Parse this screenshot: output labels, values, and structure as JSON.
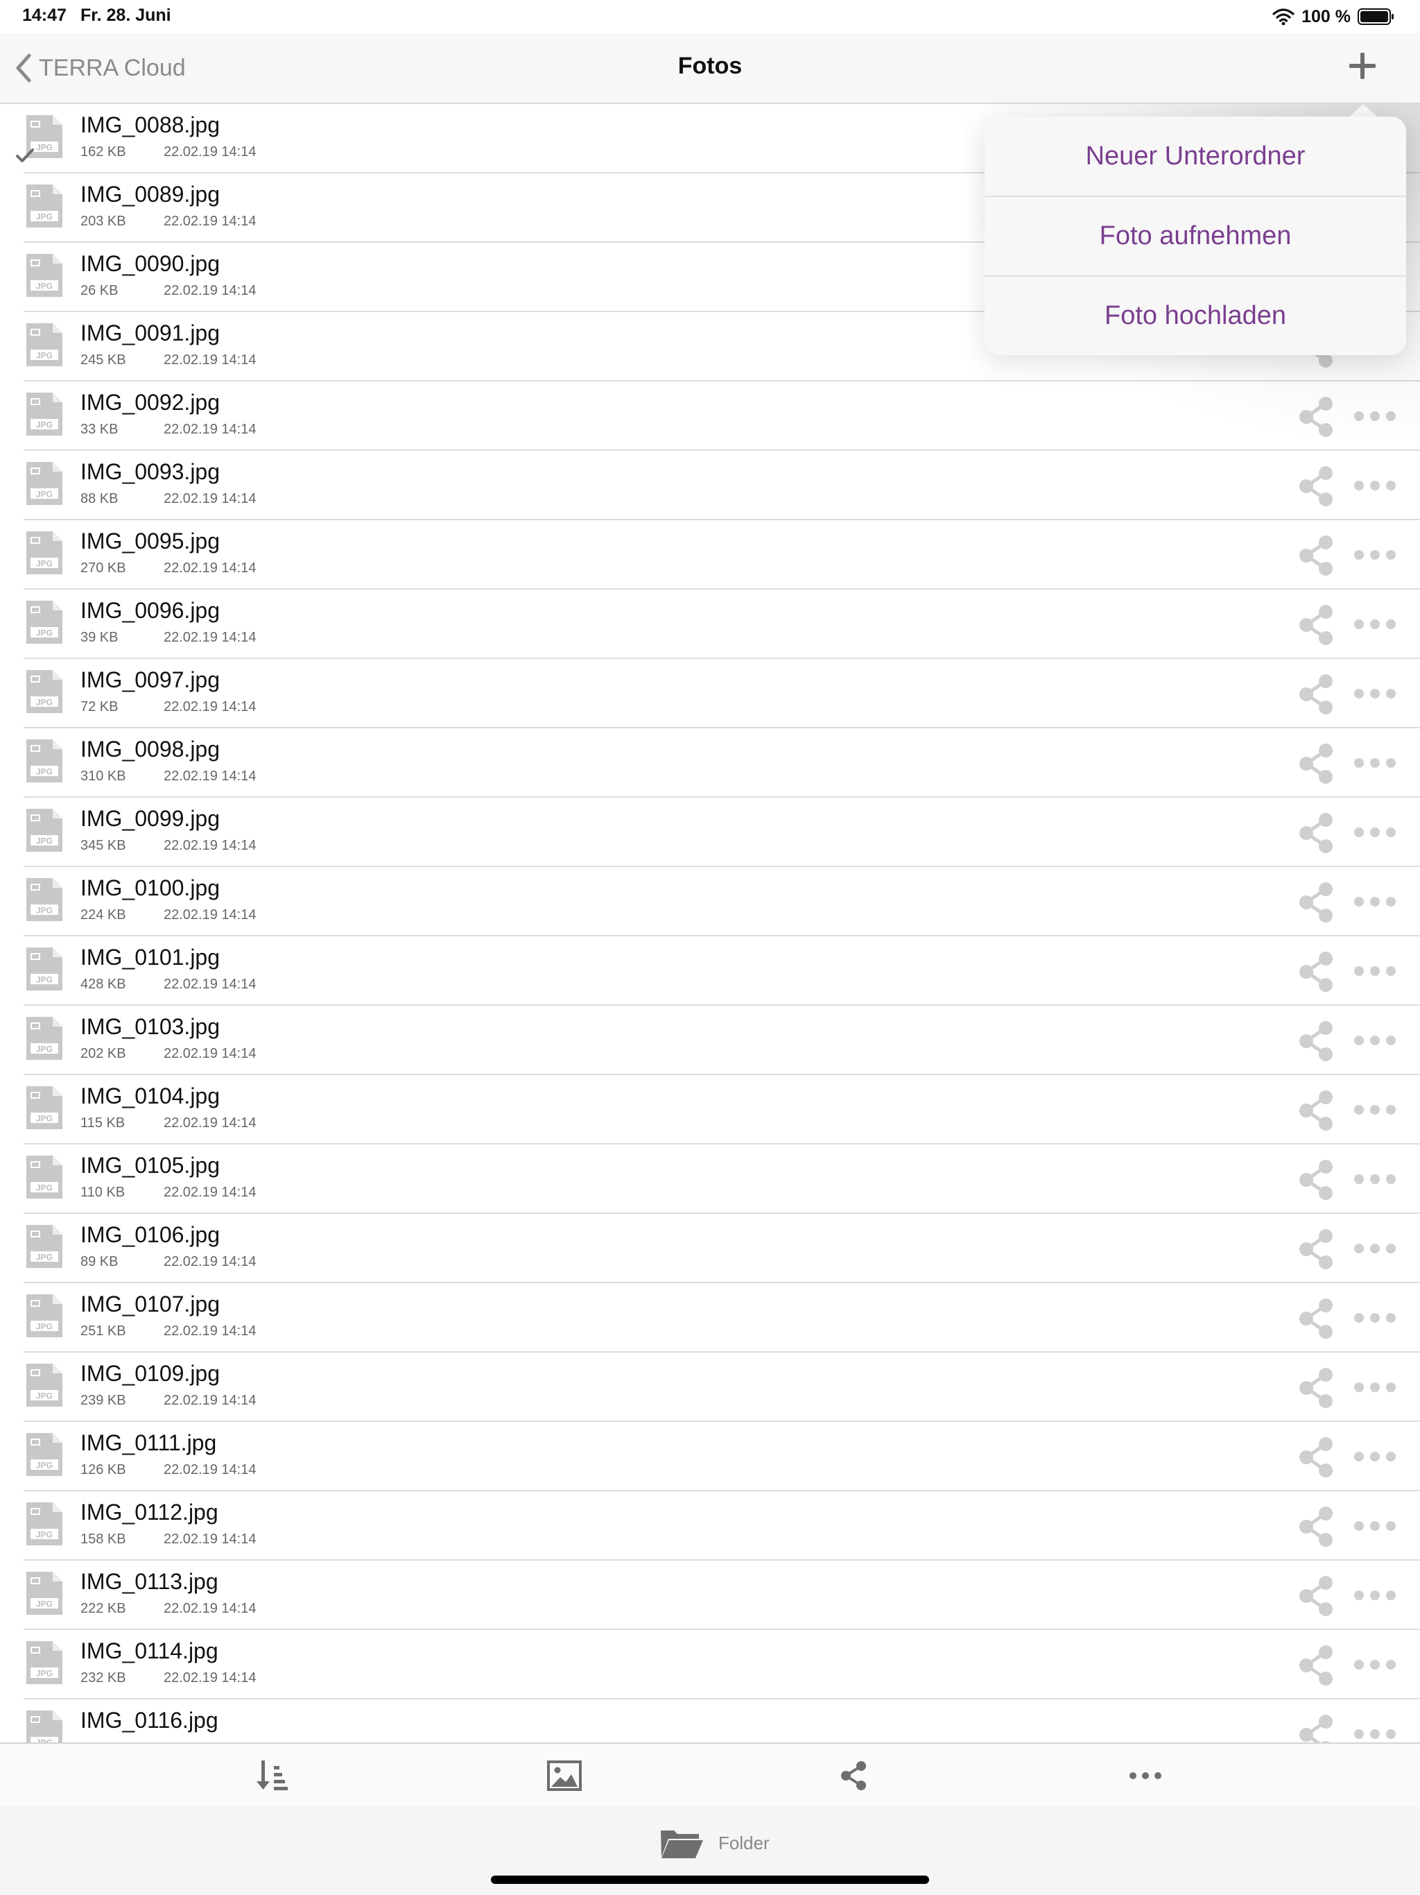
{
  "status_bar": {
    "time": "14:47",
    "date": "Fr. 28. Juni",
    "battery": "100 %"
  },
  "nav": {
    "back_label": "TERRA Cloud",
    "title": "Fotos"
  },
  "popover_menu": {
    "items": [
      "Neuer Unterordner",
      "Foto aufnehmen",
      "Foto hochladen"
    ]
  },
  "files": [
    {
      "name": "IMG_0088.jpg",
      "size": "162 KB",
      "date": "22.02.19 14:14",
      "checked": true
    },
    {
      "name": "IMG_0089.jpg",
      "size": "203 KB",
      "date": "22.02.19 14:14"
    },
    {
      "name": "IMG_0090.jpg",
      "size": "26 KB",
      "date": "22.02.19 14:14"
    },
    {
      "name": "IMG_0091.jpg",
      "size": "245 KB",
      "date": "22.02.19 14:14"
    },
    {
      "name": "IMG_0092.jpg",
      "size": "33 KB",
      "date": "22.02.19 14:14"
    },
    {
      "name": "IMG_0093.jpg",
      "size": "88 KB",
      "date": "22.02.19 14:14"
    },
    {
      "name": "IMG_0095.jpg",
      "size": "270 KB",
      "date": "22.02.19 14:14"
    },
    {
      "name": "IMG_0096.jpg",
      "size": "39 KB",
      "date": "22.02.19 14:14"
    },
    {
      "name": "IMG_0097.jpg",
      "size": "72 KB",
      "date": "22.02.19 14:14"
    },
    {
      "name": "IMG_0098.jpg",
      "size": "310 KB",
      "date": "22.02.19 14:14"
    },
    {
      "name": "IMG_0099.jpg",
      "size": "345 KB",
      "date": "22.02.19 14:14"
    },
    {
      "name": "IMG_0100.jpg",
      "size": "224 KB",
      "date": "22.02.19 14:14"
    },
    {
      "name": "IMG_0101.jpg",
      "size": "428 KB",
      "date": "22.02.19 14:14"
    },
    {
      "name": "IMG_0103.jpg",
      "size": "202 KB",
      "date": "22.02.19 14:14"
    },
    {
      "name": "IMG_0104.jpg",
      "size": "115 KB",
      "date": "22.02.19 14:14"
    },
    {
      "name": "IMG_0105.jpg",
      "size": "110 KB",
      "date": "22.02.19 14:14"
    },
    {
      "name": "IMG_0106.jpg",
      "size": "89 KB",
      "date": "22.02.19 14:14"
    },
    {
      "name": "IMG_0107.jpg",
      "size": "251 KB",
      "date": "22.02.19 14:14"
    },
    {
      "name": "IMG_0109.jpg",
      "size": "239 KB",
      "date": "22.02.19 14:14"
    },
    {
      "name": "IMG_0111.jpg",
      "size": "126 KB",
      "date": "22.02.19 14:14"
    },
    {
      "name": "IMG_0112.jpg",
      "size": "158 KB",
      "date": "22.02.19 14:14"
    },
    {
      "name": "IMG_0113.jpg",
      "size": "222 KB",
      "date": "22.02.19 14:14"
    },
    {
      "name": "IMG_0114.jpg",
      "size": "232 KB",
      "date": "22.02.19 14:14"
    },
    {
      "name": "IMG_0116.jpg",
      "size": "",
      "date": ""
    }
  ],
  "file_icon_label": "JPG",
  "toolbar": {
    "buttons": [
      "sort-icon",
      "gallery-icon",
      "share-icon",
      "more-icon"
    ]
  },
  "folder_tab": {
    "label": "Folder"
  },
  "colors": {
    "accent": "#7a3e8f",
    "icon_gray": "#c8c8c8",
    "nav_gray": "#8a8a8a"
  }
}
